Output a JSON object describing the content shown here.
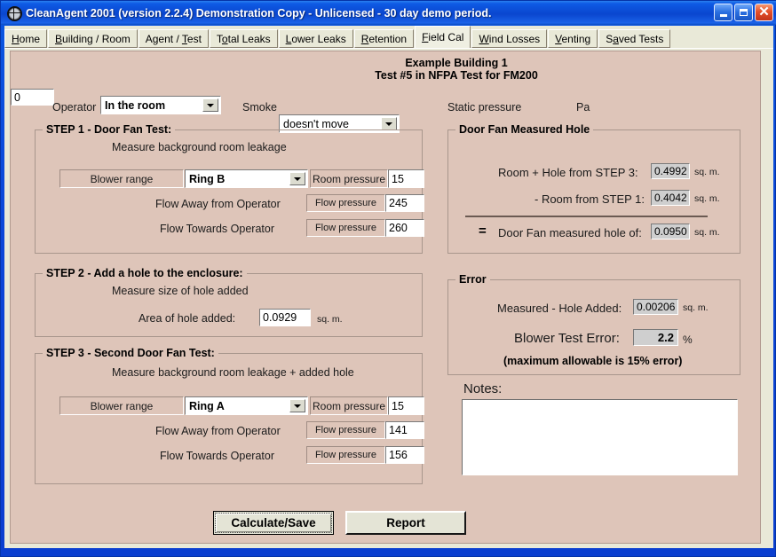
{
  "window": {
    "title": "CleanAgent 2001 (version 2.2.4) Demonstration Copy - Unlicensed - 30 day demo period.",
    "icon": "crosshair-target-icon",
    "minimize": "_",
    "maximize": "□",
    "close": "✕"
  },
  "tabs": [
    {
      "label": "Home",
      "accel": "H",
      "active": false
    },
    {
      "label": "Building / Room",
      "accel": "B",
      "active": false
    },
    {
      "label": "Agent / Test",
      "accel": "T",
      "active": false
    },
    {
      "label": "Total Leaks",
      "accel": "o",
      "active": false
    },
    {
      "label": "Lower Leaks",
      "accel": "L",
      "active": false
    },
    {
      "label": "Retention",
      "accel": "R",
      "active": false
    },
    {
      "label": "Field Cal",
      "accel": "F",
      "active": true
    },
    {
      "label": "Wind Losses",
      "accel": "W",
      "active": false
    },
    {
      "label": "Venting",
      "accel": "V",
      "active": false
    },
    {
      "label": "Saved Tests",
      "accel": "a",
      "active": false
    }
  ],
  "header": {
    "line1": "Example Building 1",
    "line2": "Test #5 in NFPA Test for FM200"
  },
  "toolbar": {
    "operator_label": "Operator",
    "operator_value": "In the room",
    "smoke_label": "Smoke",
    "smoke_value": "doesn't move",
    "static_pressure_label": "Static pressure",
    "static_pressure_value": "0",
    "static_pressure_unit": "Pa"
  },
  "step1": {
    "title": "STEP 1 - Door Fan Test:",
    "subtitle": "Measure background room leakage",
    "blower_range_label": "Blower range",
    "blower_range_value": "Ring B",
    "room_pressure_label": "Room pressure",
    "room_pressure_value": "15",
    "flow_away_label": "Flow Away from Operator",
    "flow_away_field_label": "Flow pressure",
    "flow_away_value": "245",
    "flow_towards_label": "Flow Towards Operator",
    "flow_towards_field_label": "Flow pressure",
    "flow_towards_value": "260"
  },
  "step2": {
    "title": "STEP 2 - Add a hole to the enclosure:",
    "subtitle": "Measure size of hole added",
    "area_label": "Area of hole added:",
    "area_value": "0.0929",
    "area_unit": "sq. m."
  },
  "step3": {
    "title": "STEP 3 - Second Door Fan Test:",
    "subtitle": "Measure background room leakage + added hole",
    "blower_range_label": "Blower range",
    "blower_range_value": "Ring A",
    "room_pressure_label": "Room pressure",
    "room_pressure_value": "15",
    "flow_away_label": "Flow Away from Operator",
    "flow_away_field_label": "Flow pressure",
    "flow_away_value": "141",
    "flow_towards_label": "Flow Towards Operator",
    "flow_towards_field_label": "Flow pressure",
    "flow_towards_value": "156"
  },
  "measured_hole": {
    "title": "Door Fan Measured Hole",
    "row1_label": "Room + Hole from STEP 3:",
    "row1_value": "0.4992",
    "row1_unit": "sq. m.",
    "row2_label": "- Room from STEP 1:",
    "row2_value": "0.4042",
    "row2_unit": "sq. m.",
    "equals_sign": "=",
    "row3_label": "Door Fan measured hole of:",
    "row3_value": "0.0950",
    "row3_unit": "sq. m."
  },
  "error": {
    "title": "Error",
    "row1_label": "Measured - Hole Added:",
    "row1_value": "0.00206",
    "row1_unit": "sq. m.",
    "row2_label": "Blower Test Error:",
    "row2_value": "2.2",
    "row2_unit": "%",
    "note": "(maximum allowable is 15% error)"
  },
  "notes": {
    "label": "Notes:",
    "value": ""
  },
  "buttons": {
    "calculate": "Calculate/Save",
    "report": "Report"
  },
  "colors": {
    "page_background": "#dec5b9",
    "chrome": "#e9e9d8",
    "titlebar": "#0a46cf",
    "readonly_field": "#cfcfcf"
  }
}
